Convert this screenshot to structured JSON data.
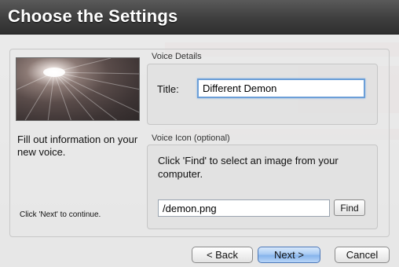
{
  "header": {
    "title": "Choose the Settings"
  },
  "sidebar": {
    "description": "Fill out information on your new voice.",
    "continue_hint": "Click 'Next' to continue."
  },
  "voice_details": {
    "group_label": "Voice Details",
    "title_label": "Title:",
    "title_value": "Different Demon"
  },
  "voice_icon": {
    "group_label": "Voice Icon (optional)",
    "instructions": "Click 'Find' to select an image from your computer.",
    "path_value": "/demon.png",
    "find_label": "Find"
  },
  "footer": {
    "back_label": "< Back",
    "next_label": "Next >",
    "cancel_label": "Cancel"
  },
  "colors": {
    "header": "#3e3e3e",
    "default_button": "#86b4ec",
    "focus_ring": "#6c9fd8"
  }
}
